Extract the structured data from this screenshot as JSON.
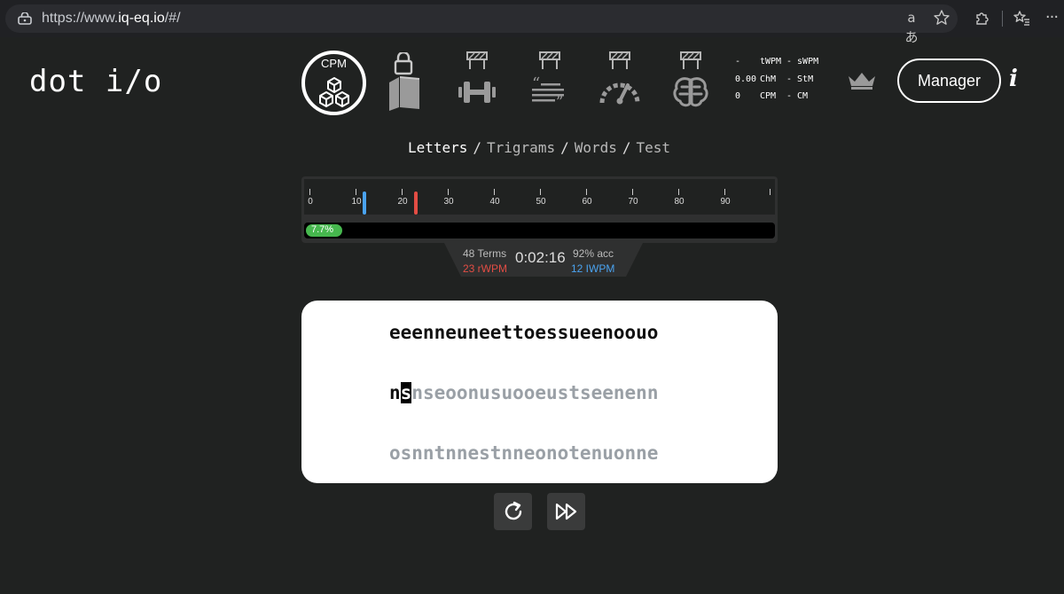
{
  "browser": {
    "url_prefix": "https://www.",
    "url_host": "iq-eq.io",
    "url_path": "/#/",
    "translate_icon": "translate-icon",
    "star_icon": "star-icon",
    "extensions_icon": "extensions-icon",
    "favorites_icon": "favorites-icon",
    "translate_glyph": "aあ"
  },
  "app": {
    "logo": "dot i/o",
    "cpm_label": "CPM",
    "mode_icons": [
      "library-icon",
      "dumbbell-icon",
      "text-lines-icon",
      "speedometer-icon",
      "brain-icon"
    ],
    "stats": [
      {
        "a": "-",
        "b": "tWPM",
        "c": "- sWPM"
      },
      {
        "a": "0.00",
        "b": "ChM",
        "c": "- StM"
      },
      {
        "a": "0",
        "b": "CPM",
        "c": "- CM"
      }
    ],
    "manager_label": "Manager",
    "info_label": "i"
  },
  "tabs": {
    "letters": "Letters",
    "trigrams": "Trigrams",
    "words": "Words",
    "test": "Test",
    "separator": "/"
  },
  "progress": {
    "ticks": [
      "0",
      "10",
      "20",
      "30",
      "40",
      "50",
      "60",
      "70",
      "80",
      "90"
    ],
    "blue_marker_value": 12,
    "red_marker_value": 23,
    "marker_colors": {
      "blue": "#4aa3f0",
      "red": "#e34d44"
    },
    "percent_label": "7.7%",
    "percent_value": 7.7,
    "terms": "48 Terms",
    "rwpm": "23 rWPM",
    "time": "0:02:16",
    "acc": "92% acc",
    "iwpm": "12 IWPM"
  },
  "text": {
    "line1": "eeenneuneettoessueenoouo",
    "line2_typed": "n",
    "line2_cursor": "s",
    "line2_rest": "nseoonusuooeustseenenn",
    "line3": "osnntnnestnneonotenuonne"
  },
  "controls": {
    "restart_icon": "restart-icon",
    "skip_icon": "fast-forward-icon"
  }
}
